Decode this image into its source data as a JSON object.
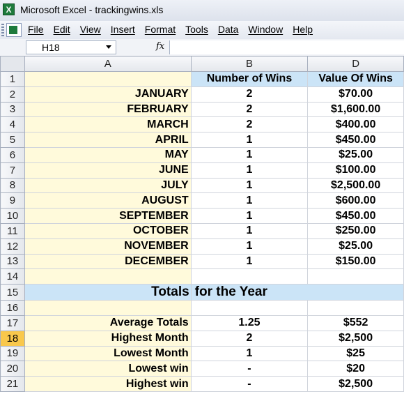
{
  "window": {
    "title": "Microsoft Excel - trackingwins.xls",
    "app_icon": "excel-icon"
  },
  "menu": [
    "File",
    "Edit",
    "View",
    "Insert",
    "Format",
    "Tools",
    "Data",
    "Window",
    "Help"
  ],
  "formula_bar": {
    "name_box": "H18",
    "fx_label": "fx",
    "formula": ""
  },
  "columns": [
    "A",
    "B",
    "D"
  ],
  "headers": {
    "wins": "Number of Wins",
    "value": "Value Of Wins"
  },
  "months": [
    {
      "row": "2",
      "month": "JANUARY",
      "wins": "2",
      "value": "$70.00"
    },
    {
      "row": "3",
      "month": "FEBRUARY",
      "wins": "2",
      "value": "$1,600.00"
    },
    {
      "row": "4",
      "month": "MARCH",
      "wins": "2",
      "value": "$400.00"
    },
    {
      "row": "5",
      "month": "APRIL",
      "wins": "1",
      "value": "$450.00"
    },
    {
      "row": "6",
      "month": "MAY",
      "wins": "1",
      "value": "$25.00"
    },
    {
      "row": "7",
      "month": "JUNE",
      "wins": "1",
      "value": "$100.00"
    },
    {
      "row": "8",
      "month": "JULY",
      "wins": "1",
      "value": "$2,500.00"
    },
    {
      "row": "9",
      "month": "AUGUST",
      "wins": "1",
      "value": "$600.00"
    },
    {
      "row": "10",
      "month": "SEPTEMBER",
      "wins": "1",
      "value": "$450.00"
    },
    {
      "row": "11",
      "month": "OCTOBER",
      "wins": "1",
      "value": "$250.00"
    },
    {
      "row": "12",
      "month": "NOVEMBER",
      "wins": "1",
      "value": "$25.00"
    },
    {
      "row": "13",
      "month": "DECEMBER",
      "wins": "1",
      "value": "$150.00"
    }
  ],
  "totals_title_part1": "Totals",
  "totals_title_part2": "for the Year",
  "summary": [
    {
      "row": "17",
      "label": "Average Totals",
      "wins": "1.25",
      "value": "$552"
    },
    {
      "row": "18",
      "label": "Highest Month",
      "wins": "2",
      "value": "$2,500"
    },
    {
      "row": "19",
      "label": "Lowest Month",
      "wins": "1",
      "value": "$25"
    },
    {
      "row": "20",
      "label": "Lowest win",
      "wins": "-",
      "value": "$20"
    },
    {
      "row": "21",
      "label": "Highest win",
      "wins": "-",
      "value": "$2,500"
    }
  ],
  "row_numbers": {
    "header": "1",
    "blank14": "14",
    "band": "15",
    "blank16": "16"
  },
  "selected_row": "18",
  "colors": {
    "label_fill": "#fffadb",
    "header_fill": "#cbe4f7",
    "selected_row_header": "#f9c84c"
  }
}
